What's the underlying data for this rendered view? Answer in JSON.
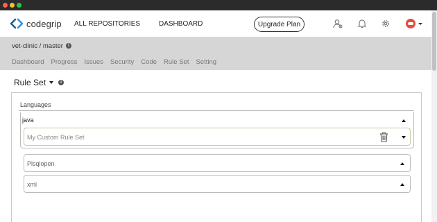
{
  "topnav": {
    "logo_text": "codegrip",
    "all_repositories": "ALL REPOSITORIES",
    "dashboard": "DASHBOARD",
    "upgrade_plan": "Upgrade Plan"
  },
  "repo": {
    "name": "vet-clinic / master",
    "info_glyph": "i",
    "tabs": [
      "Dashboard",
      "Progress",
      "Issues",
      "Security",
      "Code",
      "Rule Set",
      "Setting"
    ]
  },
  "ruleset": {
    "title": "Rule Set",
    "info_glyph": "i"
  },
  "languages": {
    "label": "Languages",
    "java": {
      "name": "java",
      "rule_set_value": "My Custom Rule Set"
    },
    "others": [
      "Plsqlopen",
      "xml"
    ]
  },
  "colors": {
    "accent_logo": "#1f5f8b",
    "repo_bar_bg": "#d6d6d6",
    "avatar": "#e74c3c"
  },
  "icons": {
    "user": "user-icon",
    "bell": "bell-icon",
    "gear": "gear-icon",
    "trash": "trash-icon"
  }
}
